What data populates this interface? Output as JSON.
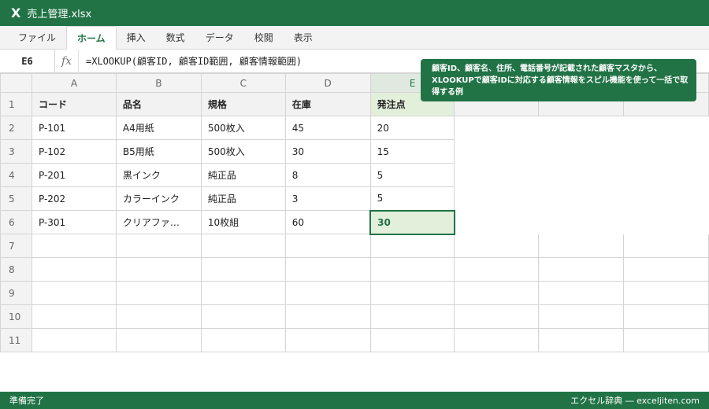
{
  "window": {
    "app_icon": "X",
    "title": "売上管理.xlsx"
  },
  "ribbon": {
    "tabs": [
      "ファイル",
      "ホーム",
      "挿入",
      "数式",
      "データ",
      "校閲",
      "表示"
    ],
    "active_tab": "ホーム"
  },
  "formula_bar": {
    "cell_ref": "E6",
    "fx_label": "fx",
    "formula": "=XLOOKUP(顧客ID, 顧客ID範囲, 顧客情報範囲)"
  },
  "sheet": {
    "columns": [
      "A",
      "B",
      "C",
      "D",
      "E",
      "",
      "",
      ""
    ],
    "selected_column": "E",
    "rows": [
      {
        "num": "1",
        "cells": [
          "コード",
          "品名",
          "規格",
          "在庫",
          "発注点"
        ]
      },
      {
        "num": "2",
        "cells": [
          "P-101",
          "A4用紙",
          "500枚入",
          "45",
          "20"
        ]
      },
      {
        "num": "3",
        "cells": [
          "P-102",
          "B5用紙",
          "500枚入",
          "30",
          "15"
        ]
      },
      {
        "num": "4",
        "cells": [
          "P-201",
          "黒インク",
          "純正品",
          "8",
          "5"
        ]
      },
      {
        "num": "5",
        "cells": [
          "P-202",
          "カラーインク",
          "純正品",
          "3",
          "5"
        ]
      },
      {
        "num": "6",
        "cells": [
          "P-301",
          "クリアファ…",
          "10枚組",
          "60",
          "30"
        ]
      },
      {
        "num": "7",
        "cells": []
      },
      {
        "num": "8",
        "cells": []
      },
      {
        "num": "9",
        "cells": []
      },
      {
        "num": "10",
        "cells": []
      },
      {
        "num": "11",
        "cells": []
      }
    ]
  },
  "callout": {
    "text": "顧客ID、顧客名、住所、電話番号が記載された顧客マスタから、XLOOKUPで顧客IDに対応する顧客情報をスピル機能を使って一括で取得する例"
  },
  "status_bar": {
    "left": "準備完了",
    "right": "エクセル辞典 ― exceljiten.com"
  },
  "colors": {
    "accent": "#217346",
    "selected_fill": "#e2efda",
    "header_fill": "#f2f2f2"
  }
}
